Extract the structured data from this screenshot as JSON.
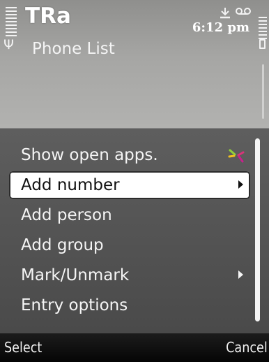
{
  "header": {
    "app_title": "TRa",
    "subtitle": "Phone List",
    "time": "6:12 pm",
    "indicator_icons": [
      "download-icon",
      "voicemail-icon"
    ]
  },
  "menu": {
    "items": [
      {
        "label": "Show open apps.",
        "icon": "app-switcher-icon"
      },
      {
        "label": "Add number",
        "submenu": true,
        "selected": true
      },
      {
        "label": "Add person"
      },
      {
        "label": "Add group"
      },
      {
        "label": "Mark/Unmark",
        "submenu": true
      },
      {
        "label": "Entry options"
      }
    ]
  },
  "softkeys": {
    "left": "Select",
    "right": "Cancel"
  },
  "colors": {
    "menu_background": "#555555",
    "selection": "#ffffff",
    "softkey_bar": "#0d0d0d"
  }
}
